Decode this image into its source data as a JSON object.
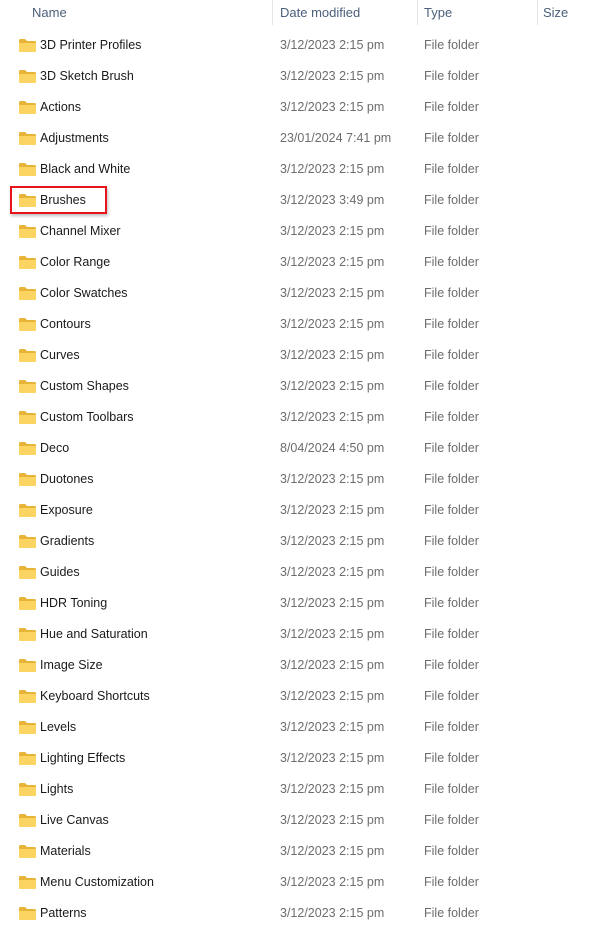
{
  "header": {
    "name": "Name",
    "date": "Date modified",
    "type": "Type",
    "size": "Size"
  },
  "highlighted": "Brushes",
  "items": [
    {
      "name": "3D Printer Profiles",
      "date": "3/12/2023 2:15 pm",
      "type": "File folder"
    },
    {
      "name": "3D Sketch Brush",
      "date": "3/12/2023 2:15 pm",
      "type": "File folder"
    },
    {
      "name": "Actions",
      "date": "3/12/2023 2:15 pm",
      "type": "File folder"
    },
    {
      "name": "Adjustments",
      "date": "23/01/2024 7:41 pm",
      "type": "File folder"
    },
    {
      "name": "Black and White",
      "date": "3/12/2023 2:15 pm",
      "type": "File folder"
    },
    {
      "name": "Brushes",
      "date": "3/12/2023 3:49 pm",
      "type": "File folder"
    },
    {
      "name": "Channel Mixer",
      "date": "3/12/2023 2:15 pm",
      "type": "File folder"
    },
    {
      "name": "Color Range",
      "date": "3/12/2023 2:15 pm",
      "type": "File folder"
    },
    {
      "name": "Color Swatches",
      "date": "3/12/2023 2:15 pm",
      "type": "File folder"
    },
    {
      "name": "Contours",
      "date": "3/12/2023 2:15 pm",
      "type": "File folder"
    },
    {
      "name": "Curves",
      "date": "3/12/2023 2:15 pm",
      "type": "File folder"
    },
    {
      "name": "Custom Shapes",
      "date": "3/12/2023 2:15 pm",
      "type": "File folder"
    },
    {
      "name": "Custom Toolbars",
      "date": "3/12/2023 2:15 pm",
      "type": "File folder"
    },
    {
      "name": "Deco",
      "date": "8/04/2024 4:50 pm",
      "type": "File folder"
    },
    {
      "name": "Duotones",
      "date": "3/12/2023 2:15 pm",
      "type": "File folder"
    },
    {
      "name": "Exposure",
      "date": "3/12/2023 2:15 pm",
      "type": "File folder"
    },
    {
      "name": "Gradients",
      "date": "3/12/2023 2:15 pm",
      "type": "File folder"
    },
    {
      "name": "Guides",
      "date": "3/12/2023 2:15 pm",
      "type": "File folder"
    },
    {
      "name": "HDR Toning",
      "date": "3/12/2023 2:15 pm",
      "type": "File folder"
    },
    {
      "name": "Hue and Saturation",
      "date": "3/12/2023 2:15 pm",
      "type": "File folder"
    },
    {
      "name": "Image Size",
      "date": "3/12/2023 2:15 pm",
      "type": "File folder"
    },
    {
      "name": "Keyboard Shortcuts",
      "date": "3/12/2023 2:15 pm",
      "type": "File folder"
    },
    {
      "name": "Levels",
      "date": "3/12/2023 2:15 pm",
      "type": "File folder"
    },
    {
      "name": "Lighting Effects",
      "date": "3/12/2023 2:15 pm",
      "type": "File folder"
    },
    {
      "name": "Lights",
      "date": "3/12/2023 2:15 pm",
      "type": "File folder"
    },
    {
      "name": "Live Canvas",
      "date": "3/12/2023 2:15 pm",
      "type": "File folder"
    },
    {
      "name": "Materials",
      "date": "3/12/2023 2:15 pm",
      "type": "File folder"
    },
    {
      "name": "Menu Customization",
      "date": "3/12/2023 2:15 pm",
      "type": "File folder"
    },
    {
      "name": "Patterns",
      "date": "3/12/2023 2:15 pm",
      "type": "File folder"
    }
  ]
}
